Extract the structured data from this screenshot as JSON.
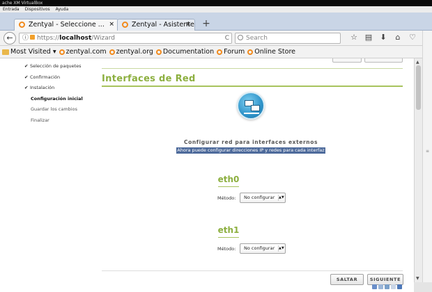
{
  "vbox": {
    "title": "ache XM VirtualBox",
    "menu": [
      "Entrada",
      "Dispositivos",
      "Ayuda"
    ]
  },
  "tabs": [
    {
      "label": "Zentyal - Seleccione ...",
      "close": "×"
    },
    {
      "label": "Zentyal - Asistente d...",
      "close": "×"
    }
  ],
  "new_tab": "+",
  "url": {
    "scheme": "https://",
    "host": "localhost",
    "path": "/Wizard",
    "reload": "C"
  },
  "search": {
    "placeholder": "Search"
  },
  "toolbar_icons": [
    "star-icon",
    "reading-list-icon",
    "download-icon",
    "home-icon",
    "pocket-icon",
    "menu-icon"
  ],
  "bookmarks": [
    {
      "label": "Most Visited ▾",
      "icon": "folder-icon"
    },
    {
      "label": "zentyal.com",
      "icon": "zentyal-icon"
    },
    {
      "label": "zentyal.org",
      "icon": "zentyal-icon"
    },
    {
      "label": "Documentation",
      "icon": "zentyal-icon"
    },
    {
      "label": "Forum",
      "icon": "zentyal-icon"
    },
    {
      "label": "Online Store",
      "icon": "zentyal-icon"
    }
  ],
  "sidebar": {
    "items": [
      {
        "label": "Selección de paquetes",
        "state": "done"
      },
      {
        "label": "Confirmación",
        "state": "done"
      },
      {
        "label": "Instalación",
        "state": "done"
      },
      {
        "label": "Configuración inicial",
        "state": "current"
      },
      {
        "label": "Guardar los cambios",
        "state": "pending"
      },
      {
        "label": "Finalizar",
        "state": "pending"
      }
    ]
  },
  "main": {
    "title": "Interfaces de Red",
    "subtitle": "Configurar red para interfaces externos",
    "hint": "Ahora puede configurar direcciones IP y redes para cada interfaz",
    "interfaces": [
      {
        "name": "eth0",
        "method_label": "Método:",
        "method_value": "No configurar"
      },
      {
        "name": "eth1",
        "method_label": "Método:",
        "method_value": "No configurar"
      }
    ],
    "skip_label": "SALTAR",
    "next_label": "SIGUIENTE"
  },
  "colors": {
    "accent_green": "#8caf3f",
    "hint_bg": "#4d6a9b",
    "tab_strip": "#c9d5e6"
  }
}
